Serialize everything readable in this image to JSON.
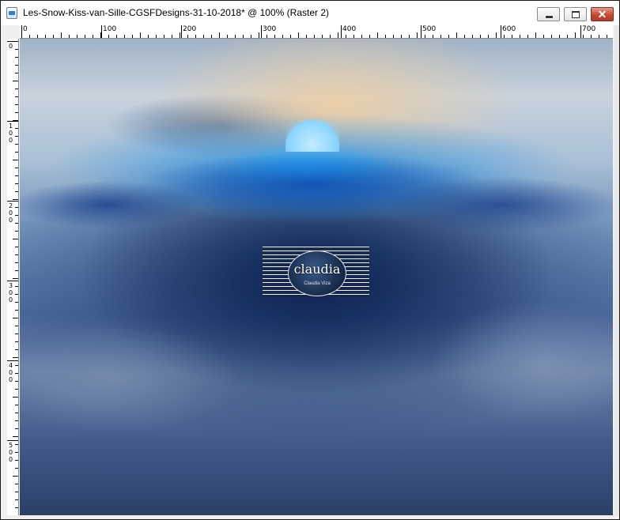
{
  "window": {
    "title": "Les-Snow-Kiss-van-Sille-CGSFDesigns-31-10-2018* @ 100% (Raster 2)",
    "minimize_label": "–",
    "maximize_label": "□",
    "close_label": "✕"
  },
  "ruler": {
    "top_labels": [
      "0",
      "100",
      "200",
      "300",
      "400",
      "500",
      "600",
      "700"
    ],
    "left_labels": [
      "0",
      "1\n0\n0",
      "2\n0\n0",
      "3\n0\n0",
      "4\n0\n0",
      "5\n0\n0"
    ]
  },
  "canvas": {
    "zoom": "100%",
    "layer": "Raster 2"
  },
  "watermark": {
    "text": "claudia",
    "subtext": "Claudia Viza"
  },
  "colors": {
    "titlebar": "#ffffff",
    "close_button": "#c44a36",
    "sky_glow": "#ebcda5",
    "cyan_glow": "#28afff",
    "bottom": "#2c4068"
  }
}
